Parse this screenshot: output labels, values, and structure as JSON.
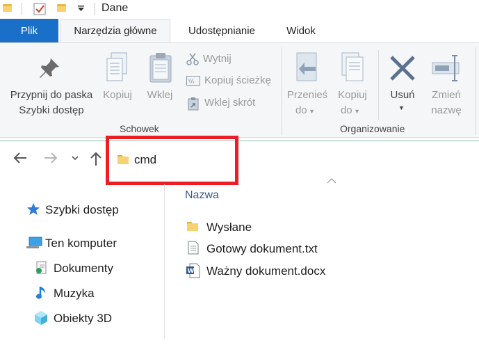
{
  "window": {
    "title": "Dane"
  },
  "quick_access": {
    "icons": [
      "folder-icon",
      "properties-checkbox-icon",
      "new-folder-icon",
      "customize-dropdown-icon"
    ]
  },
  "tabs": [
    {
      "label": "Plik",
      "active": false,
      "is_file": true
    },
    {
      "label": "Narzędzia główne",
      "active": true
    },
    {
      "label": "Udostępnianie",
      "active": false
    },
    {
      "label": "Widok",
      "active": false
    }
  ],
  "ribbon": {
    "clipboard": {
      "group_label": "Schowek",
      "pin_label_line1": "Przypnij do paska",
      "pin_label_line2": "Szybki dostęp",
      "copy_label": "Kopiuj",
      "paste_label": "Wklej",
      "cut_label": "Wytnij",
      "copy_path_label": "Kopiuj ścieżkę",
      "paste_shortcut_label": "Wklej skrót"
    },
    "organize": {
      "group_label": "Organizowanie",
      "move_line1": "Przenieś",
      "move_line2": "do",
      "copyto_line1": "Kopiuj",
      "copyto_line2": "do",
      "delete_label": "Usuń",
      "rename_line1": "Zmień",
      "rename_line2": "nazwę"
    }
  },
  "address_bar": {
    "path": "cmd"
  },
  "nav_pane": {
    "items": [
      {
        "label": "Szybki dostęp",
        "icon": "star-icon"
      },
      {
        "label": "Ten komputer",
        "icon": "computer-icon"
      },
      {
        "label": "Dokumenty",
        "icon": "documents-icon"
      },
      {
        "label": "Muzyka",
        "icon": "music-icon"
      },
      {
        "label": "Obiekty 3D",
        "icon": "3d-objects-icon"
      }
    ]
  },
  "file_list": {
    "column_header": "Nazwa",
    "files": [
      {
        "name": "Wysłane",
        "icon": "folder-icon"
      },
      {
        "name": "Gotowy dokument.txt",
        "icon": "text-file-icon"
      },
      {
        "name": "Ważny dokument.docx",
        "icon": "word-document-icon"
      }
    ]
  },
  "colors": {
    "file_tab": "#1a6fc8",
    "highlight_box": "#ee1c24",
    "folder": "#f6d370",
    "ribbon_bg": "#f5f6f7"
  }
}
